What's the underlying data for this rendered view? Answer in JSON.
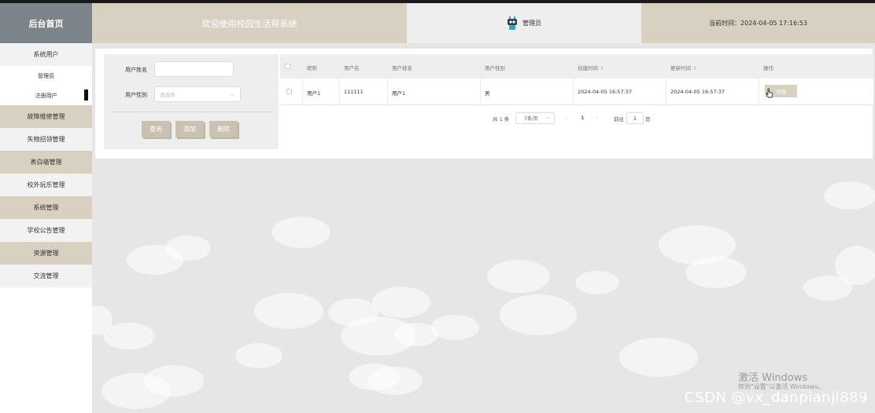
{
  "header": {
    "home": "后台首页",
    "welcome": "欢迎使用校园生活帮系统",
    "admin": "管理员",
    "time": "当前时间：2024-04-05 17:16:53"
  },
  "sidebar": {
    "items": [
      {
        "label": "系统用户",
        "style": "grey"
      },
      {
        "label": "管理员",
        "style": "sub"
      },
      {
        "label": "注册用户",
        "style": "sub-active"
      },
      {
        "label": "故障维修管理",
        "style": "tan"
      },
      {
        "label": "失物招领管理",
        "style": "grey"
      },
      {
        "label": "表白墙管理",
        "style": "tan"
      },
      {
        "label": "校外玩乐管理",
        "style": "grey"
      },
      {
        "label": "系统管理",
        "style": "tan"
      },
      {
        "label": "学校公告管理",
        "style": "grey"
      },
      {
        "label": "资源管理",
        "style": "tan"
      },
      {
        "label": "交流管理",
        "style": "grey"
      }
    ]
  },
  "filter": {
    "name_label": "用户姓名",
    "name_value": "",
    "gender_label": "用户性别",
    "gender_placeholder": "请选择",
    "query": "查询",
    "add": "添加",
    "delete": "删除"
  },
  "table": {
    "headers": [
      "昵称",
      "用户名",
      "用户姓名",
      "用户性别",
      "创建时间",
      "更新时间",
      "操作"
    ],
    "rows": [
      {
        "nickname": "用户1",
        "username": "111111",
        "realname": "用户1",
        "gender": "男",
        "created": "2024-04-05 16:57:37",
        "updated": "2024-04-05 16:57:37",
        "action": "详情"
      }
    ]
  },
  "pagination": {
    "total": "共 1 条",
    "page_size": "7条/页",
    "current": "1",
    "goto": "前往",
    "goto_value": "1",
    "page_unit": "页"
  },
  "watermarks": {
    "activate": "激活 Windows",
    "activate_hint": "转到\"设置\"以激活 Windows。",
    "csdn": "CSDN @vx_danpianji889"
  },
  "colors": {
    "tan": "#d8d1c1",
    "grey_header": "#7d8489",
    "button": "#c9c2b2"
  }
}
